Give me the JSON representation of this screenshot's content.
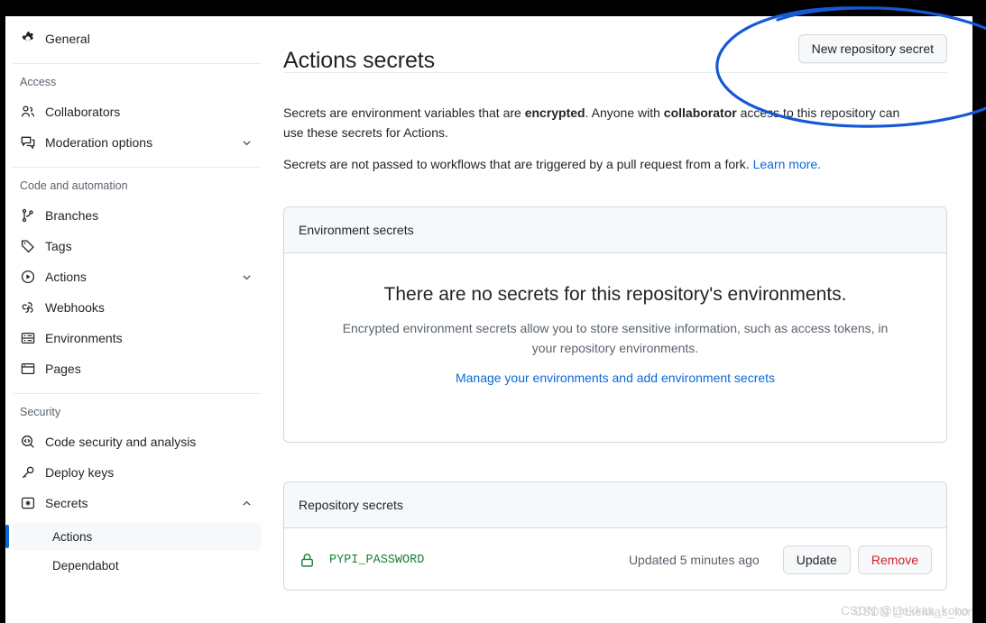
{
  "sidebar": {
    "groups": [
      {
        "title": null,
        "items": [
          {
            "label": "General",
            "icon": "gear-icon",
            "chevron": null
          }
        ]
      },
      {
        "title": "Access",
        "items": [
          {
            "label": "Collaborators",
            "icon": "people-icon",
            "chevron": null
          },
          {
            "label": "Moderation options",
            "icon": "comment-discussion-icon",
            "chevron": "chevron-down-icon"
          }
        ]
      },
      {
        "title": "Code and automation",
        "items": [
          {
            "label": "Branches",
            "icon": "git-branch-icon",
            "chevron": null
          },
          {
            "label": "Tags",
            "icon": "tag-icon",
            "chevron": null
          },
          {
            "label": "Actions",
            "icon": "play-icon",
            "chevron": "chevron-down-icon"
          },
          {
            "label": "Webhooks",
            "icon": "webhook-icon",
            "chevron": null
          },
          {
            "label": "Environments",
            "icon": "server-icon",
            "chevron": null
          },
          {
            "label": "Pages",
            "icon": "browser-icon",
            "chevron": null
          }
        ]
      },
      {
        "title": "Security",
        "items": [
          {
            "label": "Code security and analysis",
            "icon": "codescan-icon",
            "chevron": null
          },
          {
            "label": "Deploy keys",
            "icon": "key-icon",
            "chevron": null
          },
          {
            "label": "Secrets",
            "icon": "asterisk-box-icon",
            "chevron": "chevron-up-icon"
          }
        ]
      }
    ],
    "secrets_subitems": [
      {
        "label": "Actions",
        "active": true
      },
      {
        "label": "Dependabot",
        "active": false
      }
    ]
  },
  "main": {
    "page_title": "Actions secrets",
    "new_secret_button": "New repository secret",
    "intro_1_a": "Secrets are environment variables that are ",
    "intro_1_b": "encrypted",
    "intro_1_c": ". Anyone with ",
    "intro_1_d": "collaborator",
    "intro_1_e": " access to this repository can use these secrets for Actions.",
    "intro_2_a": "Secrets are not passed to workflows that are triggered by a pull request from a fork. ",
    "intro_2_link": "Learn more.",
    "environment_card": {
      "header": "Environment secrets",
      "blank_title": "There are no secrets for this repository's environments.",
      "blank_desc": "Encrypted environment secrets allow you to store sensitive information, such as access tokens, in your repository environments.",
      "blank_link": "Manage your environments and add environment secrets"
    },
    "repository_card": {
      "header": "Repository secrets",
      "rows": [
        {
          "name": "PYPI_PASSWORD",
          "updated": "Updated 5 minutes ago",
          "update_label": "Update",
          "remove_label": "Remove"
        }
      ]
    }
  },
  "annotation": {
    "shape": "hand-drawn-ellipse",
    "color": "#1558d6",
    "target": "New repository secret"
  },
  "watermark": {
    "text_front": "CSDN @Liekkas_kono",
    "text_back": "CSDN @Liekkas_kono"
  },
  "colors": {
    "accent": "#0969da",
    "annotation_blue": "#1558d6",
    "secret_green": "#1a7f37",
    "danger_red": "#cf222e",
    "muted_text": "#59636e",
    "border": "#d1d9e0",
    "surface": "#f6f8fa",
    "frame_black": "#000000"
  }
}
